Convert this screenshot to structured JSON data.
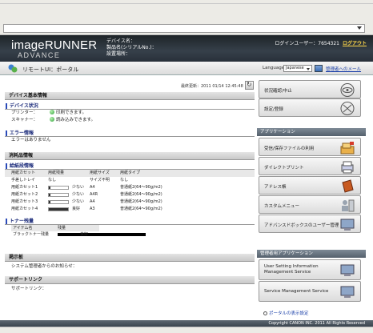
{
  "header": {
    "brand": "imageRUNNER",
    "brand_sub": "ADVANCE",
    "device_name_label": "デバイス名：",
    "product_label": "製品名(シリアルNo.)：",
    "location_label": "設置場所：",
    "login_user": "ログインユーザー：7654321",
    "logout": "ログアウト"
  },
  "titlebar": {
    "title": "リモートUI：ポータル",
    "language_label": "Language:",
    "language_value": "Japanese",
    "admin_link": "管理者へのメール"
  },
  "main": {
    "last_updated": "最終更新：2011 01/14 12:45:48",
    "device_basic": {
      "heading": "デバイス基本情報",
      "status_heading": "デバイス状況",
      "printer_label": "プリンター：",
      "printer_status": "印刷できます。",
      "scanner_label": "スキャナー：",
      "scanner_status": "読み込みできます。",
      "error_heading": "エラー情報",
      "error_text": "エラーはありません"
    },
    "consumables": {
      "heading": "消耗品情報",
      "paper_heading": "給紙段情報",
      "columns": [
        "用紙カセット",
        "用紙残量",
        "用紙サイズ",
        "用紙タイプ"
      ],
      "rows": [
        {
          "name": "手差しトレイ",
          "level_text": "なし",
          "size": "サイズ不明",
          "type": "なし",
          "level": null
        },
        {
          "name": "用紙カセット1",
          "level_text": "少ない",
          "size": "A4",
          "type": "普通紙2(64～90g/m2)",
          "level": 0.1
        },
        {
          "name": "用紙カセット2",
          "level_text": "少ない",
          "size": "A4R",
          "type": "普通紙2(64～90g/m2)",
          "level": 0.1
        },
        {
          "name": "用紙カセット3",
          "level_text": "少ない",
          "size": "A4",
          "type": "普通紙2(64～90g/m2)",
          "level": 0.1
        },
        {
          "name": "用紙カセット4",
          "level_text": "良好",
          "size": "A3",
          "type": "普通紙2(64～90g/m2)",
          "level": 1.0
        }
      ],
      "toner_heading": "トナー残量",
      "toner_columns": [
        "アイテム名",
        "残量"
      ],
      "toner_item": "ブラックトナー残量",
      "toner_status": "良好",
      "toner_level": 1.0
    },
    "notice": {
      "heading": "掲示板",
      "text": "システム管理者からのお知らせ："
    },
    "support": {
      "heading": "サポートリンク",
      "text": "サポートリンク："
    }
  },
  "side": {
    "items_top": [
      {
        "label": "状況確認/中止",
        "icon": "status-eye-icon"
      },
      {
        "label": "設定/登録",
        "icon": "settings-icon"
      }
    ],
    "apps_heading": "アプリケーション",
    "apps": [
      {
        "label": "受信/保存ファイルの利用",
        "icon": "mailbox-icon"
      },
      {
        "label": "ダイレクトプリント",
        "icon": "printer-icon"
      },
      {
        "label": "アドレス帳",
        "icon": "address-book-icon"
      },
      {
        "label": "カスタムメニュー",
        "icon": "custom-menu-icon"
      },
      {
        "label": "アドバンスドボックスのユーザー管理",
        "icon": "advanced-box-icon"
      }
    ],
    "mgmt_heading": "管理者用アプリケーション",
    "mgmt": [
      {
        "label": "User Setting Information Management Service",
        "icon": "monitor-icon"
      },
      {
        "label": "Service Management Service",
        "icon": "monitor-icon"
      }
    ],
    "portal_settings": "ポータルの表示設定"
  },
  "footer": {
    "copyright": "Copyright CANON INC. 2011 All Rights Reserved"
  }
}
